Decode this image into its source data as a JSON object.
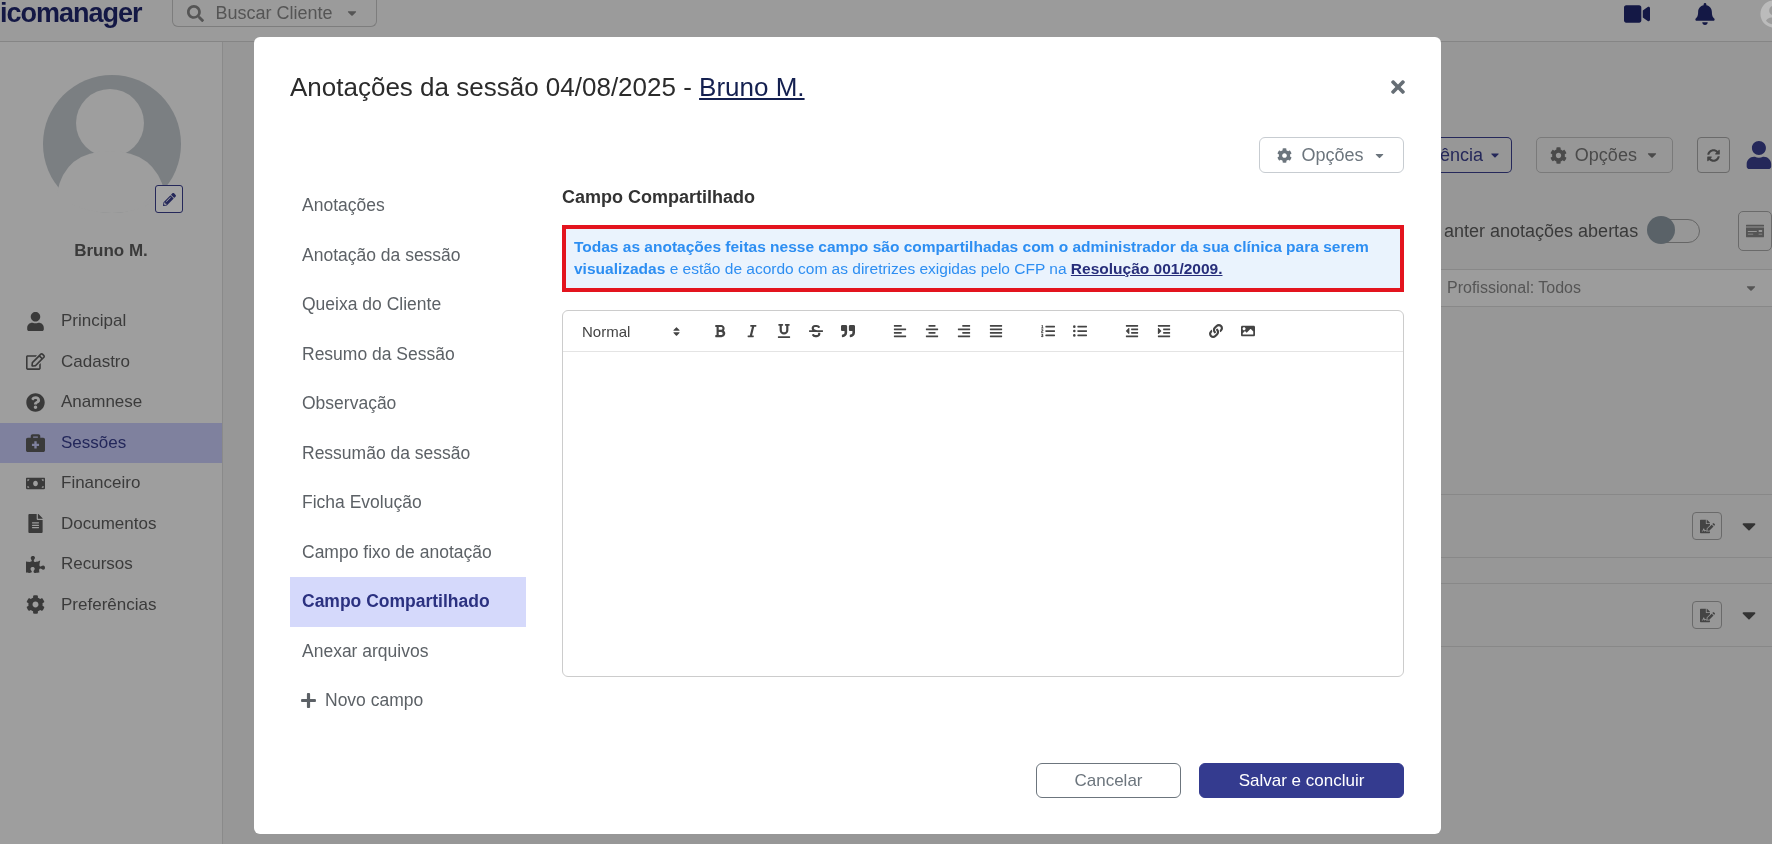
{
  "header": {
    "logo": "icomanager",
    "search_placeholder": "Buscar Cliente"
  },
  "sidebar": {
    "client_name": "Bruno M.",
    "items": [
      {
        "label": "Principal",
        "selected": false
      },
      {
        "label": "Cadastro",
        "selected": false
      },
      {
        "label": "Anamnese",
        "selected": false
      },
      {
        "label": "Sessões",
        "selected": true
      },
      {
        "label": "Financeiro",
        "selected": false
      },
      {
        "label": "Documentos",
        "selected": false
      },
      {
        "label": "Recursos",
        "selected": false
      },
      {
        "label": "Preferências",
        "selected": false
      }
    ]
  },
  "background": {
    "view_button": "ência",
    "options_button": "Opções",
    "toggle_label": "anter anotações abertas",
    "toggle_on": false,
    "filter": "Profissional: Todos"
  },
  "modal": {
    "title": "Anotações da sessão 04/08/2025 - ",
    "client_link": "Bruno M.",
    "options_button": "Opções",
    "nav": [
      {
        "label": "Anotações",
        "selected": false
      },
      {
        "label": "Anotação da sessão",
        "selected": false
      },
      {
        "label": "Queixa do Cliente",
        "selected": false
      },
      {
        "label": "Resumo da Sessão",
        "selected": false
      },
      {
        "label": "Observação",
        "selected": false
      },
      {
        "label": "Ressumão da sessão",
        "selected": false
      },
      {
        "label": "Ficha Evolução",
        "selected": false
      },
      {
        "label": "Campo fixo de anotação",
        "selected": false
      },
      {
        "label": "Campo Compartilhado",
        "selected": true
      },
      {
        "label": "Anexar arquivos",
        "selected": false
      }
    ],
    "add_field": "Novo campo",
    "section_title": "Campo Compartilhado",
    "notice": "**Todas as anotações feitas nesse campo são compartilhadas com o administrador da sua clínica para serem visualizadas** e estão de acordo com as diretrizes exigidas pelo CFP na ",
    "notice_link": "Resolução 001/2009.",
    "editor": {
      "format": "Normal"
    },
    "buttons": [
      {
        "label": "Cancelar",
        "kind": "secondary"
      },
      {
        "label": "Salvar e concluir",
        "kind": "primary"
      }
    ]
  }
}
